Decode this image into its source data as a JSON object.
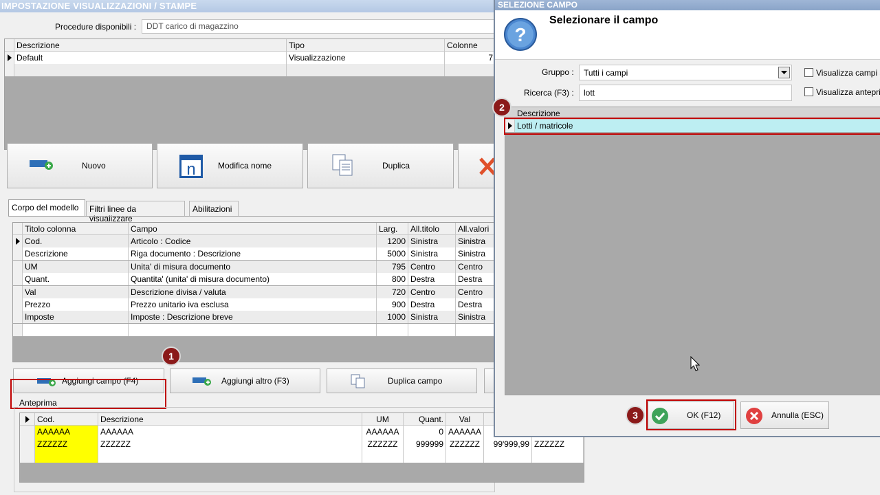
{
  "main": {
    "title": "IMPOSTAZIONE VISUALIZZAZIONI / STAMPE",
    "procedure_label": "Procedure disponibili :",
    "procedure_value": "DDT carico di magazzino",
    "models_grid": {
      "headers": [
        "Descrizione",
        "Tipo",
        "Colonne"
      ],
      "rows": [
        {
          "descrizione": "Default",
          "tipo": "Visualizzazione",
          "colonne": "7"
        }
      ]
    },
    "action_buttons": {
      "nuovo": "Nuovo",
      "modifica_nome": "Modifica nome",
      "duplica": "Duplica"
    },
    "tabs": [
      "Corpo del modello",
      "Filtri linee da visualizzare",
      "Abilitazioni"
    ],
    "columns_grid": {
      "headers": [
        "Titolo colonna",
        "Campo",
        "Larg.",
        "All.titolo",
        "All.valori"
      ],
      "rows": [
        {
          "titolo": "Cod.",
          "campo": "Articolo : Codice",
          "larg": "1200",
          "all_titolo": "Sinistra",
          "all_valori": "Sinistra"
        },
        {
          "titolo": "Descrizione",
          "campo": "Riga documento : Descrizione",
          "larg": "5000",
          "all_titolo": "Sinistra",
          "all_valori": "Sinistra"
        },
        {
          "titolo": "UM",
          "campo": "Unita' di misura documento",
          "larg": "795",
          "all_titolo": "Centro",
          "all_valori": "Centro"
        },
        {
          "titolo": "Quant.",
          "campo": "Quantita' (unita' di misura documento)",
          "larg": "800",
          "all_titolo": "Destra",
          "all_valori": "Destra"
        },
        {
          "titolo": "Val",
          "campo": "Descrizione divisa / valuta",
          "larg": "720",
          "all_titolo": "Centro",
          "all_valori": "Centro"
        },
        {
          "titolo": "Prezzo",
          "campo": "Prezzo unitario iva esclusa",
          "larg": "900",
          "all_titolo": "Destra",
          "all_valori": "Destra"
        },
        {
          "titolo": "Imposte",
          "campo": "Imposte : Descrizione breve",
          "larg": "1000",
          "all_titolo": "Sinistra",
          "all_valori": "Sinistra"
        }
      ]
    },
    "field_buttons": {
      "aggiungi_campo": "Aggiungi campo (F4)",
      "aggiungi_altro": "Aggiungi altro (F3)",
      "duplica_campo": "Duplica campo"
    },
    "preview": {
      "label": "Anteprima",
      "headers": [
        "Cod.",
        "Descrizione",
        "UM",
        "Quant.",
        "Val",
        "",
        ""
      ],
      "rows": [
        [
          "AAAAAA",
          "AAAAAA",
          "AAAAAA",
          "0",
          "AAAAAA",
          "",
          ""
        ],
        [
          "ZZZZZZ",
          "ZZZZZZ",
          "ZZZZZZ",
          "999999",
          "ZZZZZZ",
          "99'999,99",
          "ZZZZZZ"
        ]
      ]
    }
  },
  "dialog": {
    "title": "SELEZIONE CAMPO",
    "heading": "Selezionare il campo",
    "gruppo_label": "Gruppo :",
    "gruppo_value": "Tutti i campi",
    "ricerca_label": "Ricerca (F3) :",
    "ricerca_value": "lott",
    "checkbox_1": "Visualizza campi s",
    "checkbox_2": "Visualizza antepri",
    "grid_header": "Descrizione",
    "grid_rows": [
      "Lotti / matricole"
    ],
    "ok_label": "OK (F12)",
    "annulla_label": "Annulla (ESC)"
  },
  "callouts": [
    "1",
    "2",
    "3"
  ],
  "colors": {
    "callout": "#8b1a1a",
    "highlight_box": "#c00000",
    "selected_row": "#bdeef2",
    "preview_cod": "#ffff00"
  },
  "icons": [
    "add-field-icon",
    "rename-icon",
    "duplicate-icon",
    "delete-icon",
    "question-icon",
    "ok-check-icon",
    "cancel-x-icon",
    "dropdown-arrow-icon",
    "mouse-cursor-icon"
  ]
}
